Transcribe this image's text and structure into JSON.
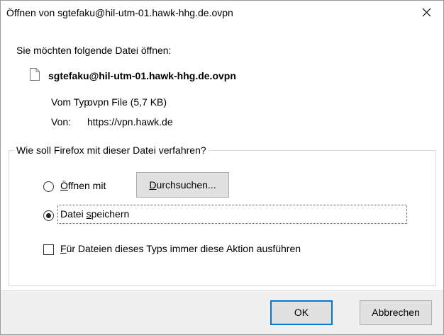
{
  "window": {
    "title": "Öffnen von sgtefaku@hil-utm-01.hawk-hhg.de.ovpn",
    "close_glyph": "✕"
  },
  "prompt": "Sie möchten folgende Datei öffnen:",
  "file": {
    "icon": "document-icon",
    "name": "sgtefaku@hil-utm-01.hawk-hhg.de.ovpn",
    "type_label": "Vom Typ:",
    "type_value": "ovpn File (5,7 KB)",
    "from_label": "Von:",
    "from_value": "https://vpn.hawk.de"
  },
  "action_group": {
    "legend": "Wie soll Firefox mit dieser Datei verfahren?",
    "open_with": {
      "label_first": "Ö",
      "label_rest": "ffnen mit",
      "selected": false
    },
    "browse_button": {
      "label_first": "D",
      "label_rest": "urchsuchen..."
    },
    "save_file": {
      "label_first": "Datei ",
      "label_underlined": "s",
      "label_rest": "peichern",
      "selected": true
    },
    "always_checkbox": {
      "label_first": "F",
      "label_rest": "ür Dateien dieses Typs immer diese Aktion ausführen",
      "checked": false
    }
  },
  "buttons": {
    "ok": "OK",
    "cancel": "Abbrechen"
  },
  "colors": {
    "default_button_border": "#0078d7",
    "button_face": "#e1e1e1",
    "footer_bg": "#f0f0f0"
  }
}
